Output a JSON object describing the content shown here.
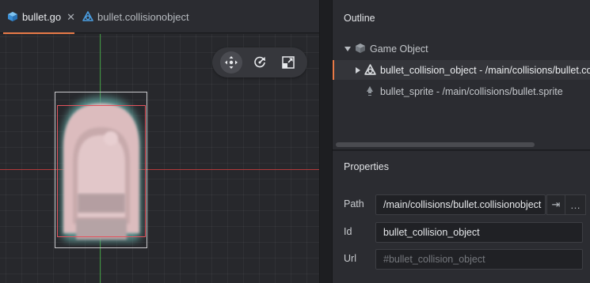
{
  "tabs": [
    {
      "label": "bullet.go",
      "icon": "cube-icon",
      "active": true,
      "close": "✕"
    },
    {
      "label": "bullet.collisionobject",
      "icon": "collision-object-icon",
      "active": false
    }
  ],
  "toolbar": {
    "tools": [
      {
        "name": "move-tool-icon",
        "active": true
      },
      {
        "name": "rotate-tool-icon",
        "active": false
      },
      {
        "name": "scale-tool-icon",
        "active": false
      }
    ]
  },
  "outline": {
    "title": "Outline",
    "root": {
      "label": "Game Object",
      "icon": "cube-icon"
    },
    "children": [
      {
        "label": "bullet_collision_object - /main/collisions/bullet.collisionobject",
        "icon": "collision-object-icon",
        "selected": true
      },
      {
        "label": "bullet_sprite - /main/collisions/bullet.sprite",
        "icon": "sprite-icon",
        "selected": false
      }
    ]
  },
  "properties": {
    "title": "Properties",
    "path": {
      "label": "Path",
      "value": "/main/collisions/bullet.collisionobject",
      "goto": "⇥",
      "more": "…"
    },
    "id": {
      "label": "Id",
      "value": "bullet_collision_object"
    },
    "url": {
      "label": "Url",
      "placeholder": "#bullet_collision_object"
    }
  },
  "colors": {
    "accent": "#e97a47",
    "x_axis": "#b43a3a",
    "y_axis": "#3f9a3f",
    "selection": "#e3535d",
    "icon_blue": "#4a9de0"
  }
}
